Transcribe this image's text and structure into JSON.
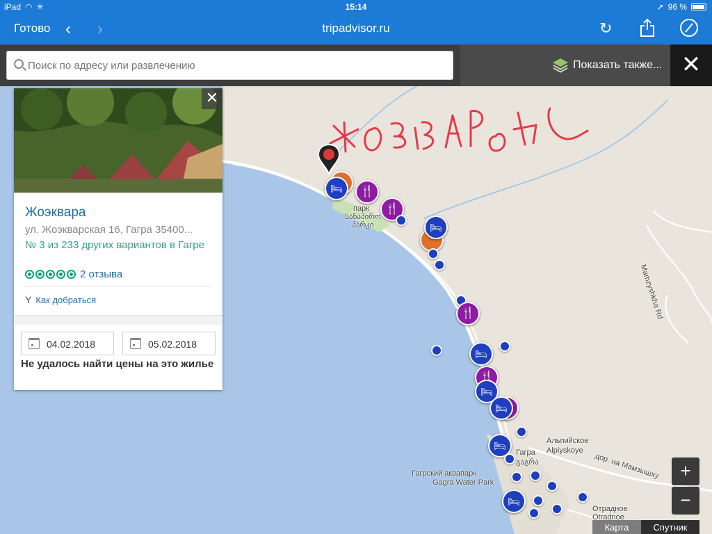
{
  "status": {
    "device": "iPad",
    "time": "15:14",
    "battery": "96 %"
  },
  "browser": {
    "done_label": "Готово",
    "url": "tripadvisor.ru"
  },
  "search": {
    "placeholder": "Поиск по адресу или развлечению",
    "value": ""
  },
  "show_also": {
    "label": "Показать также..."
  },
  "map": {
    "handwritten_text": "ЖОЭКВАРА",
    "labels": {
      "park_ru": "парк",
      "park_ka": "სანაპირო პარკი",
      "alpiyskoye_ru": "Альпийское",
      "alpiyskoye_en": "Alpiyskoye",
      "gagra_ru": "Гагра",
      "gagra_ka": "გაგრა",
      "aquapark_ru": "Гагрский аквапарк",
      "aquapark_en": "Gagra Water Park",
      "otradnoe_ru": "Отрадное",
      "otradnoe_en": "Otradnoe",
      "street_mamzyshkha": "Mamzyshkha Rd",
      "road_mamzyshkha": "дор. на Мамзышху"
    },
    "zoom_in": "+",
    "zoom_out": "−",
    "type_map": "Карта",
    "type_satellite": "Спутник"
  },
  "card": {
    "name": "Жоэквара",
    "address": "ул. Жоэкварская 16, Гагра 35400...",
    "rank": "№ 3 из 233 других вариантов в Гагре",
    "rating": 5,
    "reviews": "2 отзыва",
    "directions": "Как добраться",
    "checkin": "04.02.2018",
    "checkout": "05.02.2018",
    "no_price": "Не удалось найти цены на это жилье"
  },
  "colors": {
    "brand_blue": "#1c7bd6",
    "hotel_marker": "#1f3fbf",
    "food_marker": "#8e1aa6",
    "attraction_marker": "#e0702a",
    "tripadvisor_green": "#00a680"
  }
}
